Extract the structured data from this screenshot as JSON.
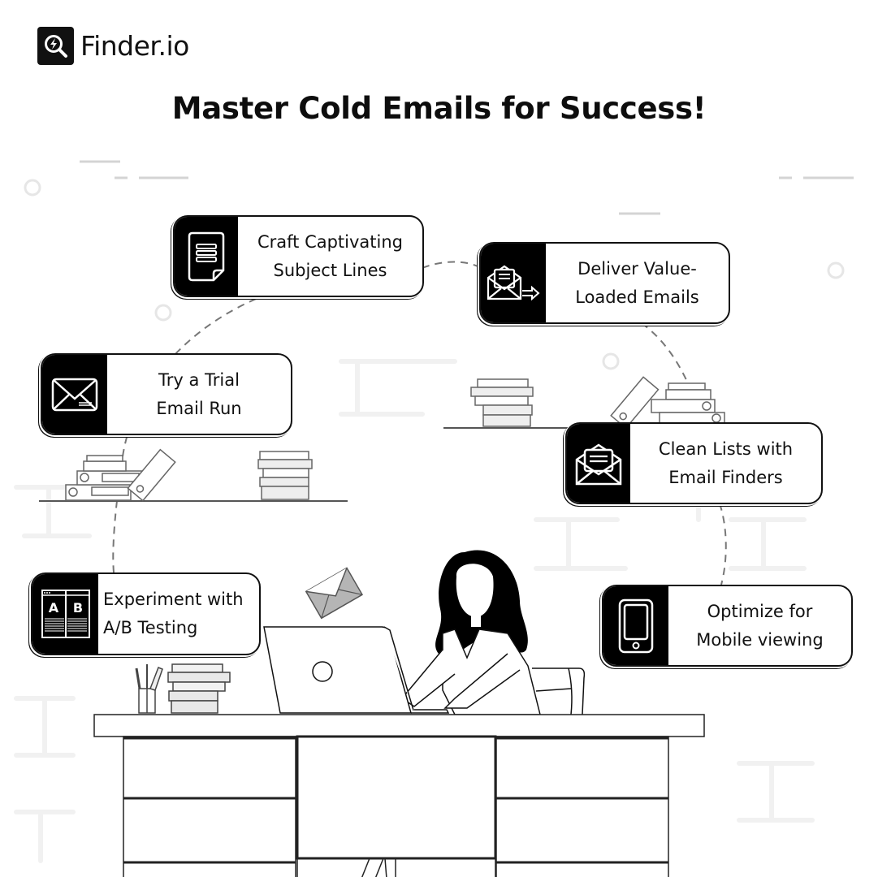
{
  "brand": {
    "name": "Finder.io",
    "logo_icon": "search-lightning-icon"
  },
  "title": "Master Cold Emails for Success!",
  "steps": [
    {
      "label": "Craft Captivating\nSubject Lines",
      "icon": "document-icon"
    },
    {
      "label": "Deliver Value-\nLoaded Emails",
      "icon": "send-email-icon"
    },
    {
      "label": "Try a Trial\nEmail Run",
      "icon": "envelope-icon"
    },
    {
      "label": "Clean Lists with\nEmail Finders",
      "icon": "open-envelope-icon"
    },
    {
      "label": "Experiment with\nA/B Testing",
      "icon": "ab-test-icon"
    },
    {
      "label": "Optimize for\nMobile viewing",
      "icon": "mobile-phone-icon"
    }
  ],
  "colors": {
    "ink": "#111111",
    "background": "#ffffff",
    "decor_gray": "#d0d0d0",
    "envelope_gray": "#b5b5b5"
  }
}
